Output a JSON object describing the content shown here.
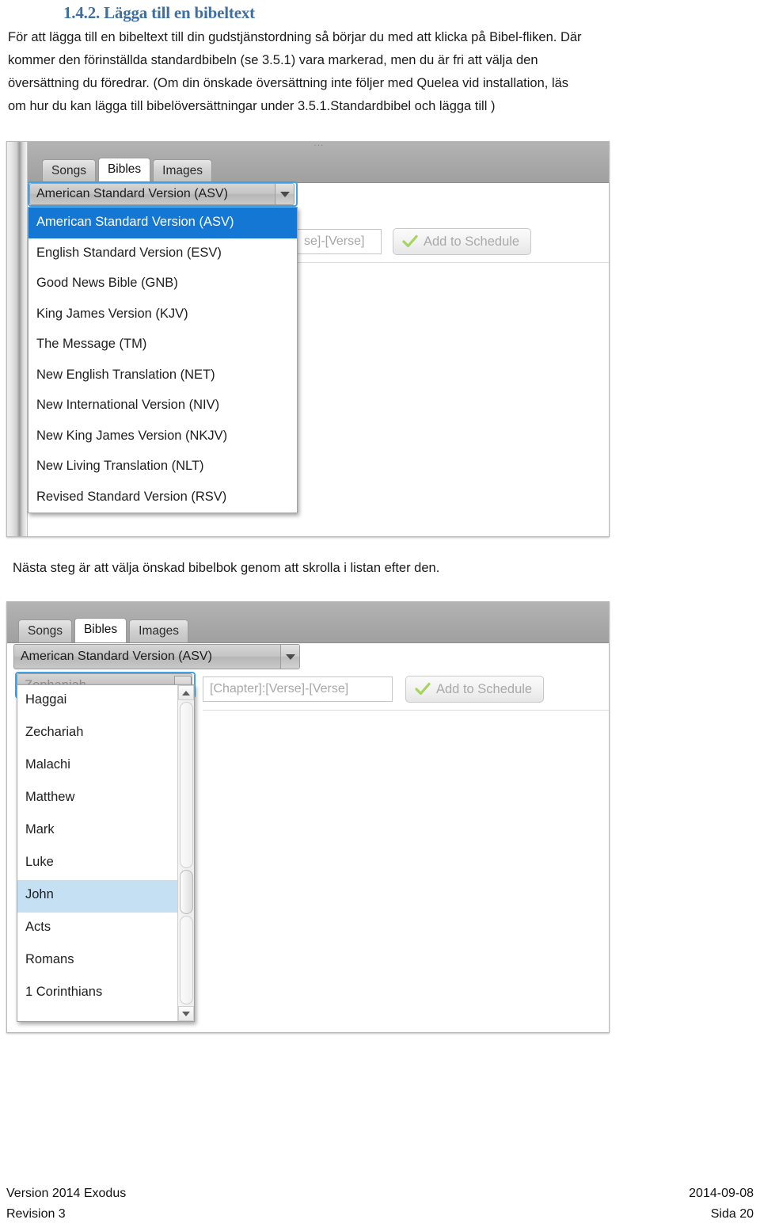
{
  "document": {
    "heading": "1.4.2. Lägga till en bibeltext",
    "paragraph_lines": [
      "För att lägga till en bibeltext till din gudstjänstordning så börjar du med att klicka på Bibel-fliken. Där",
      "kommer den förinställda standardbibeln (se 3.5.1) vara markerad, men du är fri att välja den",
      "översättning du föredrar. (Om din önskade översättning inte följer med Quelea vid installation, läs",
      "om hur du kan lägga till bibelöversättningar under 3.5.1.Standardbibel och lägga till )"
    ],
    "mid_text": "Nästa steg är att välja önskad bibelbok genom att skrolla i listan efter den."
  },
  "screenshot_one": {
    "tabs": [
      {
        "label": "Songs",
        "active": false
      },
      {
        "label": "Bibles",
        "active": true
      },
      {
        "label": "Images",
        "active": false
      }
    ],
    "translation_combo": {
      "value": "American Standard Version (ASV)",
      "arrow_icon": "chevron-down-icon"
    },
    "translation_options": [
      {
        "label": "American Standard Version (ASV)",
        "selected": true
      },
      {
        "label": "English Standard Version (ESV)",
        "selected": false
      },
      {
        "label": "Good News Bible (GNB)",
        "selected": false
      },
      {
        "label": "King James Version (KJV)",
        "selected": false
      },
      {
        "label": "The Message (TM)",
        "selected": false
      },
      {
        "label": "New English Translation (NET)",
        "selected": false
      },
      {
        "label": "New International Version (NIV)",
        "selected": false
      },
      {
        "label": "New King James Version (NKJV)",
        "selected": false
      },
      {
        "label": "New Living Translation (NLT)",
        "selected": false
      },
      {
        "label": "Revised Standard Version (RSV)",
        "selected": false
      }
    ],
    "reference_field": {
      "placeholder": "se]-[Verse]"
    },
    "add_button": {
      "label": "Add to Schedule",
      "icon": "green-check-icon",
      "icon_color": "#a6d45e"
    },
    "grip_dots": "···"
  },
  "screenshot_two": {
    "tabs": [
      {
        "label": "Songs",
        "active": false
      },
      {
        "label": "Bibles",
        "active": true
      },
      {
        "label": "Images",
        "active": false
      }
    ],
    "translation_combo": {
      "value": "American Standard Version (ASV)",
      "arrow_icon": "chevron-down-icon"
    },
    "book_combo": {
      "value": "Zephaniah"
    },
    "book_options": [
      {
        "label": "Haggai",
        "selected": false
      },
      {
        "label": "Zechariah",
        "selected": false
      },
      {
        "label": "Malachi",
        "selected": false
      },
      {
        "label": "Matthew",
        "selected": false
      },
      {
        "label": "Mark",
        "selected": false
      },
      {
        "label": "Luke",
        "selected": false
      },
      {
        "label": "John",
        "selected": true
      },
      {
        "label": "Acts",
        "selected": false
      },
      {
        "label": "Romans",
        "selected": false
      },
      {
        "label": "1 Corinthians",
        "selected": false
      }
    ],
    "reference_field": {
      "placeholder": "[Chapter]:[Verse]-[Verse]"
    },
    "add_button": {
      "label": "Add to Schedule",
      "icon": "green-check-icon",
      "icon_color": "#a6d45e"
    },
    "scrollbar": {
      "up_icon": "triangle-up-icon",
      "down_icon": "triangle-down-icon"
    }
  },
  "footer": {
    "left_line1": "Version 2014 Exodus",
    "left_line2": "Revision 3",
    "right_line1": "2014-09-08",
    "right_line2": "Sida 20"
  },
  "colors": {
    "heading": "#3e6fa3",
    "selection_blue": "#1577d4",
    "selection_light": "#c5e0f2",
    "focus_ring": "#3da3e8"
  }
}
